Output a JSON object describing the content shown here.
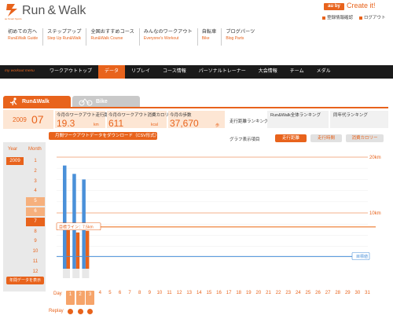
{
  "header": {
    "logo_text": "Run & Walk",
    "logo_sub": "au Smart Sports",
    "au_badge": "au by KDDI",
    "create_it": "Create it!",
    "user_links": [
      "登録情報確認",
      "ログアウト"
    ],
    "nav": [
      {
        "jp": "初めての方へ",
        "en": "Run&Walk Guide"
      },
      {
        "jp": "ステップアップ",
        "en": "Step Up Run&Walk"
      },
      {
        "jp": "全国おすすめコース",
        "en": "Run&Walk Course"
      },
      {
        "jp": "みんなのワークアウト",
        "en": "Everyone's Workout"
      },
      {
        "jp": "自転車",
        "en": "Bike"
      },
      {
        "jp": "ブログパーツ",
        "en": "Blog Parts"
      }
    ]
  },
  "menu": {
    "label": "my workout menu",
    "items": [
      "ワークアウトトップ",
      "データ",
      "リプレイ",
      "コース情報",
      "パーソナルトレーナー",
      "大会情報",
      "チーム",
      "メダル"
    ],
    "active_index": 1
  },
  "tabs": [
    "Run&Walk",
    "Bike"
  ],
  "date": {
    "year": "2009",
    "month": "07"
  },
  "stats": [
    {
      "label": "今月のワークアウト走行距離",
      "value": "19.3",
      "unit": "km"
    },
    {
      "label": "今月のワークアウト消費カロリー",
      "value": "611",
      "unit": "kcal"
    },
    {
      "label": "今月の歩数",
      "value": "37,670",
      "unit": "歩"
    }
  ],
  "ranking": {
    "distance": "走行距離ランキング",
    "overall": "Run&Walk全体ランキング",
    "age": "同年代ランキング"
  },
  "controls": {
    "csv": "月間ワークアウトデータをダウンロード（CSV形式）",
    "graph_label": "グラフ表示項目",
    "buttons": [
      "走行距離",
      "走行時間",
      "消費カロリー"
    ],
    "active_button": 0,
    "year_header": "Year",
    "month_header": "Month",
    "year": "2009",
    "months": [
      "1",
      "2",
      "3",
      "4",
      "5",
      "6",
      "7",
      "8",
      "9",
      "10",
      "11",
      "12"
    ],
    "months_with_data": [
      5,
      6
    ],
    "current_month": 7,
    "year_data": "年間データを表示"
  },
  "chart_data": {
    "type": "bar",
    "categories": [
      "1",
      "2",
      "3",
      "4",
      "5",
      "6",
      "7",
      "8",
      "9",
      "10",
      "11",
      "12",
      "13",
      "14",
      "15",
      "16",
      "17",
      "18",
      "19",
      "20",
      "21",
      "22",
      "23",
      "24",
      "25",
      "26",
      "27",
      "28",
      "29",
      "30",
      "31"
    ],
    "series": [
      {
        "name": "",
        "color": "#4a90d9",
        "values": [
          18.5,
          17.0,
          16.0,
          0,
          0,
          0,
          0,
          0,
          0,
          0,
          0,
          0,
          0,
          0,
          0,
          0,
          0,
          0,
          0,
          0,
          0,
          0,
          0,
          0,
          0,
          0,
          0,
          0,
          0,
          0,
          0
        ]
      },
      {
        "name": "",
        "color": "#e8631c",
        "values": [
          7.0,
          6.5,
          6.8,
          0,
          0,
          0,
          0,
          0,
          0,
          0,
          0,
          0,
          0,
          0,
          0,
          0,
          0,
          0,
          0,
          0,
          0,
          0,
          0,
          0,
          0,
          0,
          0,
          0,
          0,
          0,
          0
        ]
      }
    ],
    "ylim": [
      0,
      20
    ],
    "ytick_labels": [
      "20km",
      "10km"
    ],
    "target_line": {
      "label": "目標値",
      "value": 2.2
    },
    "avg_line": {
      "label": "目標ライン：7.5km",
      "value": 7.5
    },
    "xlabel": "Day",
    "replay_label": "Replay"
  }
}
